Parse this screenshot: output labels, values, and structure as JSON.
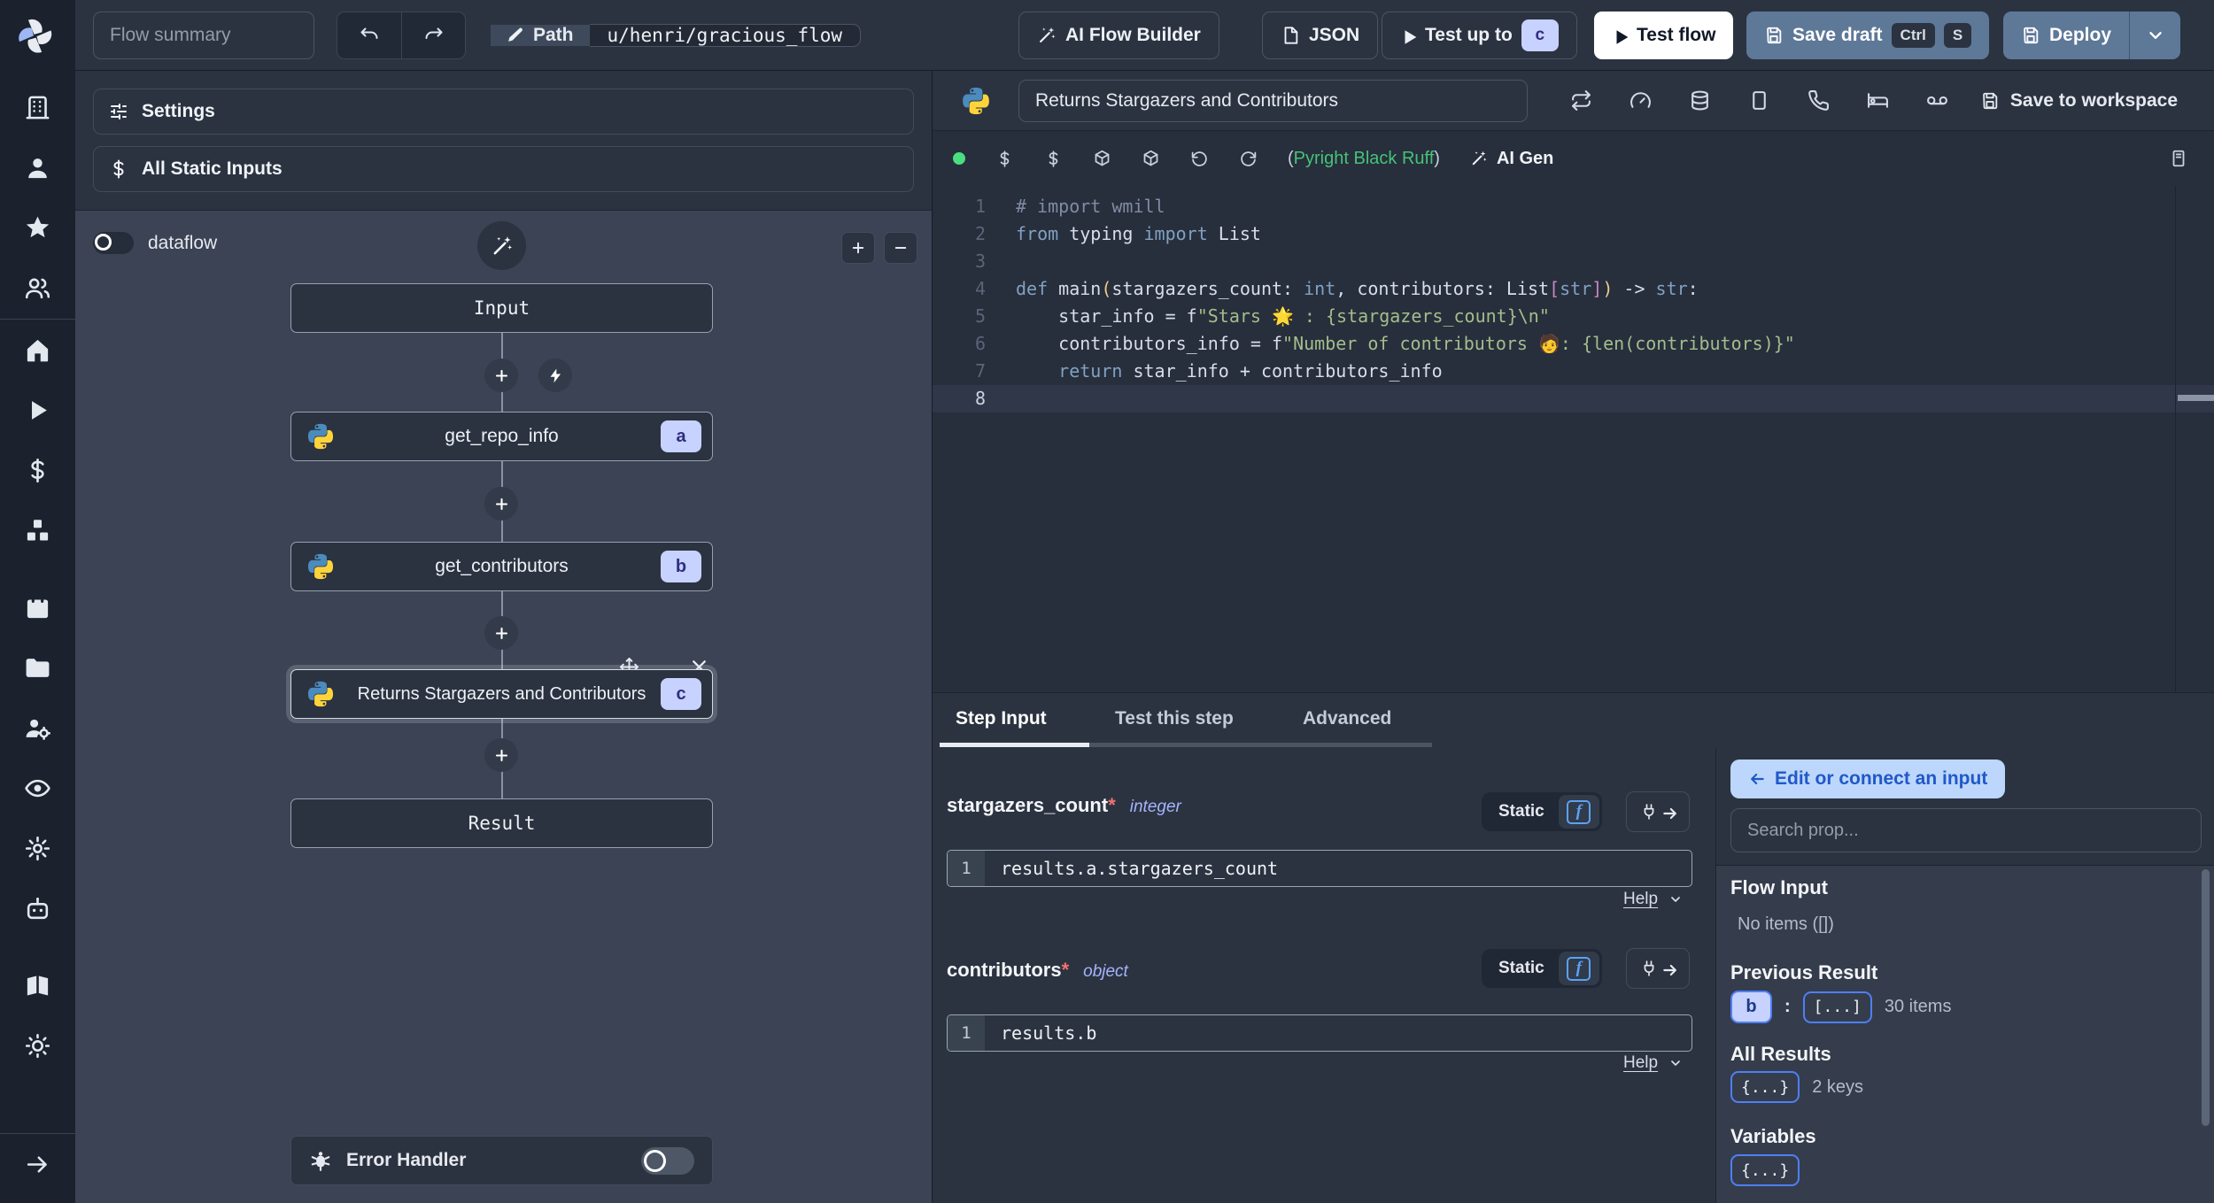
{
  "topbar": {
    "flow_summary_placeholder": "Flow summary",
    "path_label": "Path",
    "path_value": "u/henri/gracious_flow",
    "ai_flow_builder_label": "AI Flow Builder",
    "json_label": "JSON",
    "test_up_to_label": "Test up to",
    "test_up_to_step": "c",
    "test_flow_label": "Test flow",
    "save_draft_label": "Save draft",
    "save_draft_shortcut": [
      "Ctrl",
      "S"
    ],
    "deploy_label": "Deploy"
  },
  "sidebar": {
    "groups": [
      [
        "building-icon",
        "user-icon",
        "star-icon",
        "users-icon"
      ],
      [
        "home-icon",
        "play-icon",
        "dollar-icon",
        "boxes-icon"
      ],
      [
        "calendar-icon",
        "folder-icon",
        "user-cog-icon",
        "eye-icon",
        "gear-icon",
        "bot-icon"
      ],
      [
        "book-icon",
        "sun-icon"
      ]
    ],
    "footer_icon": "arrow-right-icon"
  },
  "flow_panel": {
    "settings_label": "Settings",
    "all_static_inputs_label": "All Static Inputs",
    "dataflow_label": "dataflow",
    "nodes": {
      "input": "Input",
      "step_a": {
        "label": "get_repo_info",
        "id": "a"
      },
      "step_b": {
        "label": "get_contributors",
        "id": "b"
      },
      "step_c": {
        "label": "Returns Stargazers and Contributors",
        "id": "c"
      },
      "result": "Result"
    },
    "error_handler_label": "Error Handler"
  },
  "step_editor": {
    "title_value": "Returns Stargazers and Contributors",
    "save_to_workspace_label": "Save to workspace",
    "assistants_open": "(",
    "assistants_names": "Pyright Black Ruff",
    "assistants_close": ")",
    "ai_gen_label": "AI Gen",
    "active_line": 8,
    "code": [
      [
        [
          "com",
          "# import wmill"
        ]
      ],
      [
        [
          "kw",
          "from"
        ],
        [
          "pl",
          " typing "
        ],
        [
          "kw",
          "import"
        ],
        [
          "pl",
          " List"
        ]
      ],
      [],
      [
        [
          "kw",
          "def"
        ],
        [
          "pl",
          " main"
        ],
        [
          "p1",
          "("
        ],
        [
          "pl",
          "stargazers_count: "
        ],
        [
          "kw",
          "int"
        ],
        [
          "pl",
          ", contributors: List"
        ],
        [
          "p2",
          "["
        ],
        [
          "kw",
          "str"
        ],
        [
          "p2",
          "]"
        ],
        [
          "p1",
          ")"
        ],
        [
          "pl",
          " -> "
        ],
        [
          "kw",
          "str"
        ],
        [
          "pl",
          ":"
        ]
      ],
      [
        [
          "pl",
          "    star_info = f"
        ],
        [
          "str",
          "\"Stars 🌟 : {stargazers_count}\\n\""
        ]
      ],
      [
        [
          "pl",
          "    contributors_info = f"
        ],
        [
          "str",
          "\"Number of contributors 🧑: {len(contributors)}\""
        ]
      ],
      [
        [
          "pl",
          "    "
        ],
        [
          "kw",
          "return"
        ],
        [
          "pl",
          " star_info + contributors_info"
        ]
      ],
      []
    ]
  },
  "bottom_panel": {
    "tabs": [
      "Step Input",
      "Test this step",
      "Advanced"
    ],
    "active_tab": "Step Input",
    "fields": [
      {
        "name": "stargazers_count",
        "required_marker": "*",
        "type": "integer",
        "mode": "Static",
        "line_number": "1",
        "expression": "results.a.stargazers_count",
        "help_label": "Help"
      },
      {
        "name": "contributors",
        "required_marker": "*",
        "type": "object",
        "mode": "Static",
        "line_number": "1",
        "expression": "results.b",
        "help_label": "Help"
      }
    ]
  },
  "props_panel": {
    "edit_connect_label": "Edit or connect an input",
    "search_placeholder": "Search prop...",
    "sections": {
      "flow_input": {
        "title": "Flow Input",
        "empty": "No items ([])"
      },
      "previous_result": {
        "title": "Previous Result",
        "badge": "b",
        "colon": ":",
        "value_badge": "[...]",
        "count": "30 items"
      },
      "all_results": {
        "title": "All Results",
        "value_badge": "{...}",
        "count": "2 keys"
      },
      "variables": {
        "title": "Variables",
        "value_badge": "{...}"
      }
    }
  },
  "colors": {
    "accent_lavender": "#c7d2fe",
    "accent_indigo_text": "#312e81",
    "steel_blue_button": "#5e7898",
    "connect_button_bg": "#bcd7fb",
    "status_green": "#4ade80",
    "string_green": "#a3be8c",
    "keyword_blue": "#81a1c1",
    "python_blue": "#4b8bbe",
    "python_yellow": "#ffd43b"
  }
}
